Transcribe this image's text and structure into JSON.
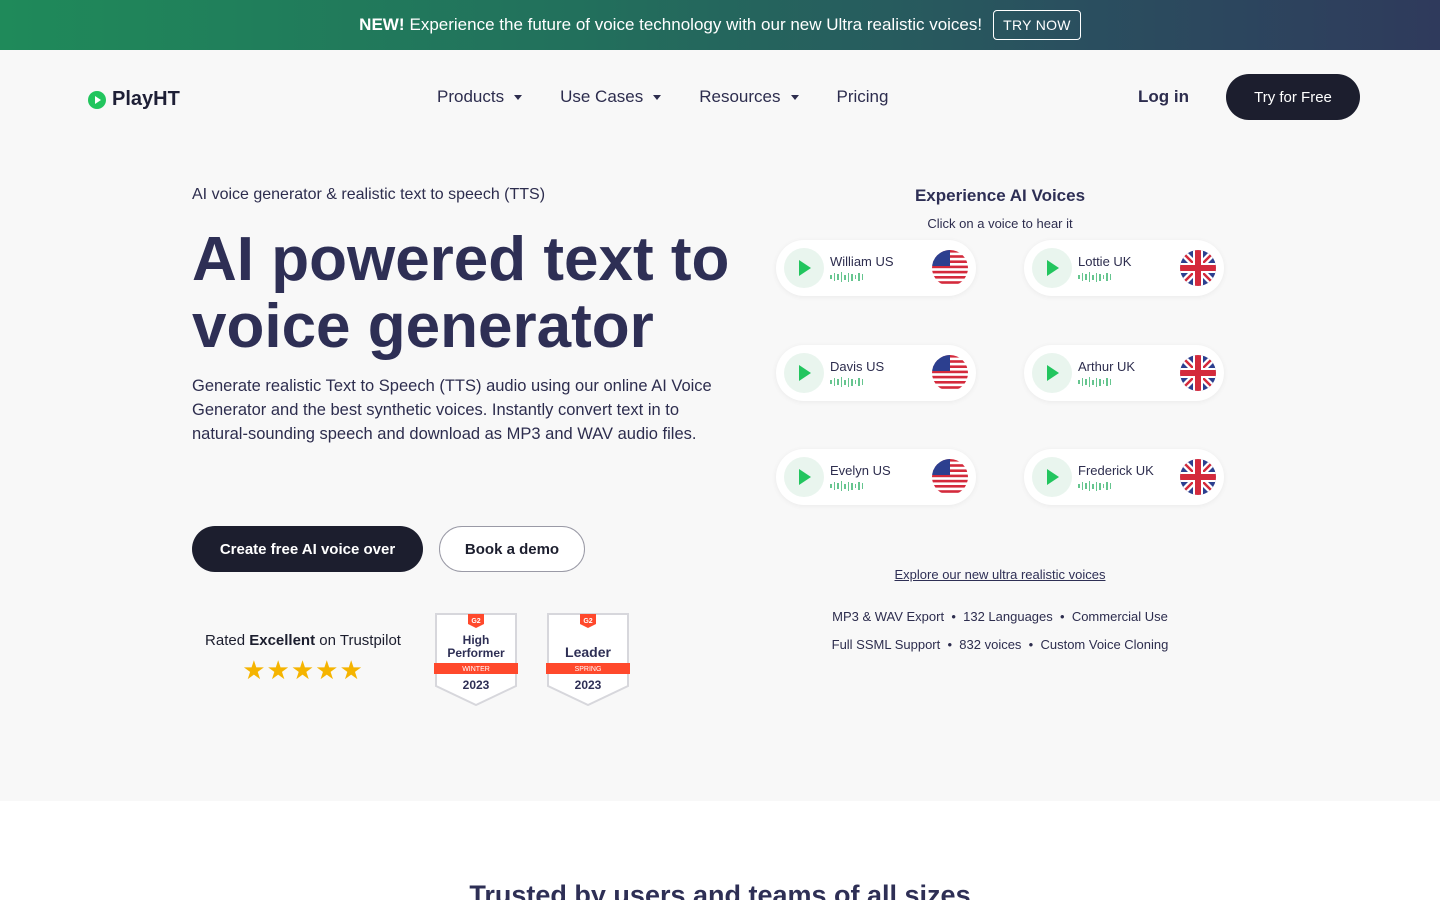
{
  "banner": {
    "new_label": "NEW!",
    "text": "Experience the future of voice technology with our new Ultra realistic voices!",
    "cta_label": "TRY NOW"
  },
  "header": {
    "logo_text": "PlayHT",
    "nav": [
      {
        "label": "Products",
        "has_dropdown": true
      },
      {
        "label": "Use Cases",
        "has_dropdown": true
      },
      {
        "label": "Resources",
        "has_dropdown": true
      },
      {
        "label": "Pricing",
        "has_dropdown": false
      }
    ],
    "login_label": "Log in",
    "try_free_label": "Try for Free"
  },
  "hero": {
    "eyebrow": "AI voice generator & realistic text to speech (TTS)",
    "headline": "AI powered text to voice generator",
    "description": "Generate realistic Text to Speech (TTS) audio using our online AI Voice Generator and the best synthetic voices. Instantly convert text in to natural-sounding speech and download as MP3 and WAV audio files.",
    "primary_cta": "Create free AI voice over",
    "secondary_cta": "Book a demo",
    "trustpilot": {
      "prefix": "Rated",
      "rating_word": "Excellent",
      "suffix": "on Trustpilot",
      "stars": 5
    },
    "badges": [
      {
        "brand": "G2",
        "title_line1": "High",
        "title_line2": "Performer",
        "season": "WINTER",
        "year": "2023"
      },
      {
        "brand": "G2",
        "title_line1": "Leader",
        "title_line2": "",
        "season": "SPRING",
        "year": "2023"
      }
    ]
  },
  "voices": {
    "title": "Experience AI Voices",
    "subtitle": "Click on a voice to hear it",
    "items": [
      {
        "name": "William US",
        "flag": "us-flag-icon"
      },
      {
        "name": "Lottie UK",
        "flag": "uk-flag-icon"
      },
      {
        "name": "Davis US",
        "flag": "us-flag-icon"
      },
      {
        "name": "Arthur UK",
        "flag": "uk-flag-icon"
      },
      {
        "name": "Evelyn US",
        "flag": "us-flag-icon"
      },
      {
        "name": "Frederick UK",
        "flag": "uk-flag-icon"
      }
    ],
    "explore_link": "Explore our new ultra realistic voices",
    "features_row1": [
      "MP3 & WAV Export",
      "132 Languages",
      "Commercial Use"
    ],
    "features_row2": [
      "Full SSML Support",
      "832 voices",
      "Custom Voice Cloning"
    ]
  },
  "trusted_heading": "Trusted by users and teams of all sizes",
  "colors": {
    "accent_green": "#22c55e",
    "navy": "#2e2f55",
    "dark_button": "#1c1e2e",
    "star": "#f5b400",
    "g2_red": "#ff492c"
  }
}
